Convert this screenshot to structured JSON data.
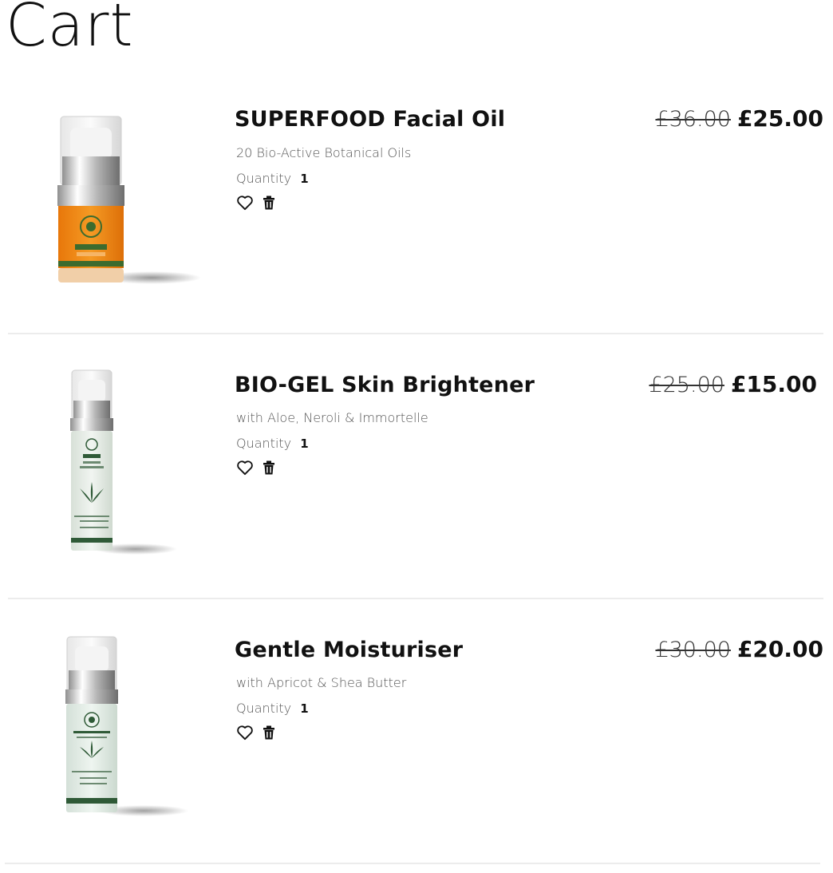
{
  "page": {
    "title": "Cart"
  },
  "items": [
    {
      "name": "SUPERFOOD Facial Oil",
      "subtitle": "20 Bio-Active Botanical Oils",
      "quantity_label": "Quantity",
      "quantity": "1",
      "price_old": "£36.00",
      "price_new": "£25.00",
      "image": {
        "bottle_color": "#f08a12",
        "label_lines": [
          "PHB",
          "SUPERFOOD",
          "FACIAL OIL",
          "ETHICAL & ORGANIC"
        ]
      }
    },
    {
      "name": "BIO-GEL Skin Brightener",
      "subtitle": "with Aloe, Neroli & Immortelle",
      "quantity_label": "Quantity",
      "quantity": "1",
      "price_old": "£25.00",
      "price_new": "£15.00",
      "image": {
        "bottle_color": "#e9efe9",
        "label_lines": [
          "PHB",
          "BIO-GEL",
          "SKIN",
          "BRIGHTENER",
          "ETHICAL & ORGANIC"
        ]
      }
    },
    {
      "name": "Gentle Moisturiser",
      "subtitle": "with Apricot & Shea Butter",
      "quantity_label": "Quantity",
      "quantity": "1",
      "price_old": "£30.00",
      "price_new": "£20.00",
      "image": {
        "bottle_color": "#e6efe8",
        "label_lines": [
          "PHB",
          "GENTLE MOISTURISER",
          "APRICOT &",
          "SHEA BUTTER",
          "ETHICAL & ORGANIC"
        ]
      }
    }
  ],
  "icons": {
    "wishlist": "heart-icon",
    "remove": "trash-icon"
  },
  "colors": {
    "text": "#111111",
    "muted": "#555555",
    "divider": "#ececec",
    "brand_green": "#2f5a37"
  }
}
